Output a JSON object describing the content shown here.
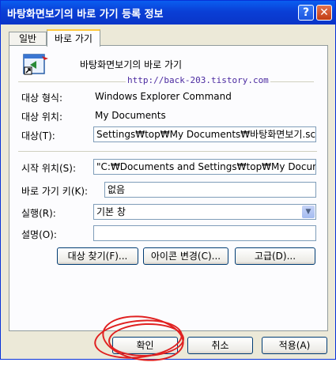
{
  "window": {
    "title": "바탕화면보기의 바로 가기 등록 정보",
    "help": "?",
    "close": "✕"
  },
  "tabs": [
    {
      "label": "일반"
    },
    {
      "label": "바로 가기"
    }
  ],
  "header": {
    "name": "바탕화면보기의 바로 가기",
    "watermark": "http://back-203.tistory.com"
  },
  "fields": {
    "target_type": {
      "label": "대상 형식:",
      "value": "Windows Explorer Command"
    },
    "target_location": {
      "label": "대상 위치:",
      "value": "My Documents"
    },
    "target": {
      "label": "대상(T):",
      "value": "Settings₩top₩My Documents₩바탕화면보기.scf\""
    },
    "start_in": {
      "label": "시작 위치(S):",
      "value": "\"C:₩Documents and Settings₩top₩My Docume"
    },
    "shortcut_key": {
      "label": "바로 가기 키(K):",
      "value": "없음"
    },
    "run": {
      "label": "실행(R):",
      "value": "기본 창"
    },
    "comment": {
      "label": "설명(O):",
      "value": ""
    }
  },
  "buttons": {
    "find_target": "대상 찾기(F)...",
    "change_icon": "아이콘 변경(C)...",
    "advanced": "고급(D)...",
    "ok": "확인",
    "cancel": "취소",
    "apply": "적용(A)"
  },
  "icons": {
    "dropdown": "chevron-down-icon",
    "shortcut": "shortcut-file-icon"
  },
  "colors": {
    "titlebar": "#0a4de0",
    "tab_highlight": "#ffc83c",
    "annotation": "#e02020"
  }
}
